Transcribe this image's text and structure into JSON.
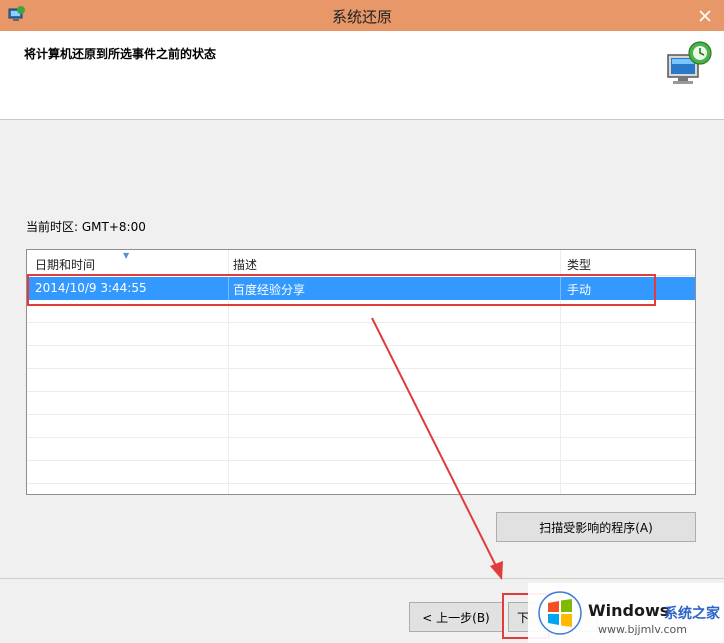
{
  "window": {
    "title": "系统还原",
    "heading": "将计算机还原到所选事件之前的状态",
    "close_icon": "close-icon"
  },
  "timezone_label": "当前时区: GMT+8:00",
  "table": {
    "columns": [
      "日期和时间",
      "描述",
      "类型"
    ],
    "rows": [
      {
        "datetime": "2014/10/9 3:44:55",
        "description": "百度经验分享",
        "type": "手动",
        "selected": true
      }
    ]
  },
  "buttons": {
    "scan": "扫描受影响的程序(A)",
    "back": "< 上一步(B)",
    "next": "下"
  },
  "watermark": {
    "brand": "Windows",
    "brand_cn": "系统之家",
    "url": "www.bjjmlv.com"
  },
  "colors": {
    "titlebar": "#e89769",
    "selection": "#3399ff",
    "annotation_red": "#e23b3b"
  }
}
